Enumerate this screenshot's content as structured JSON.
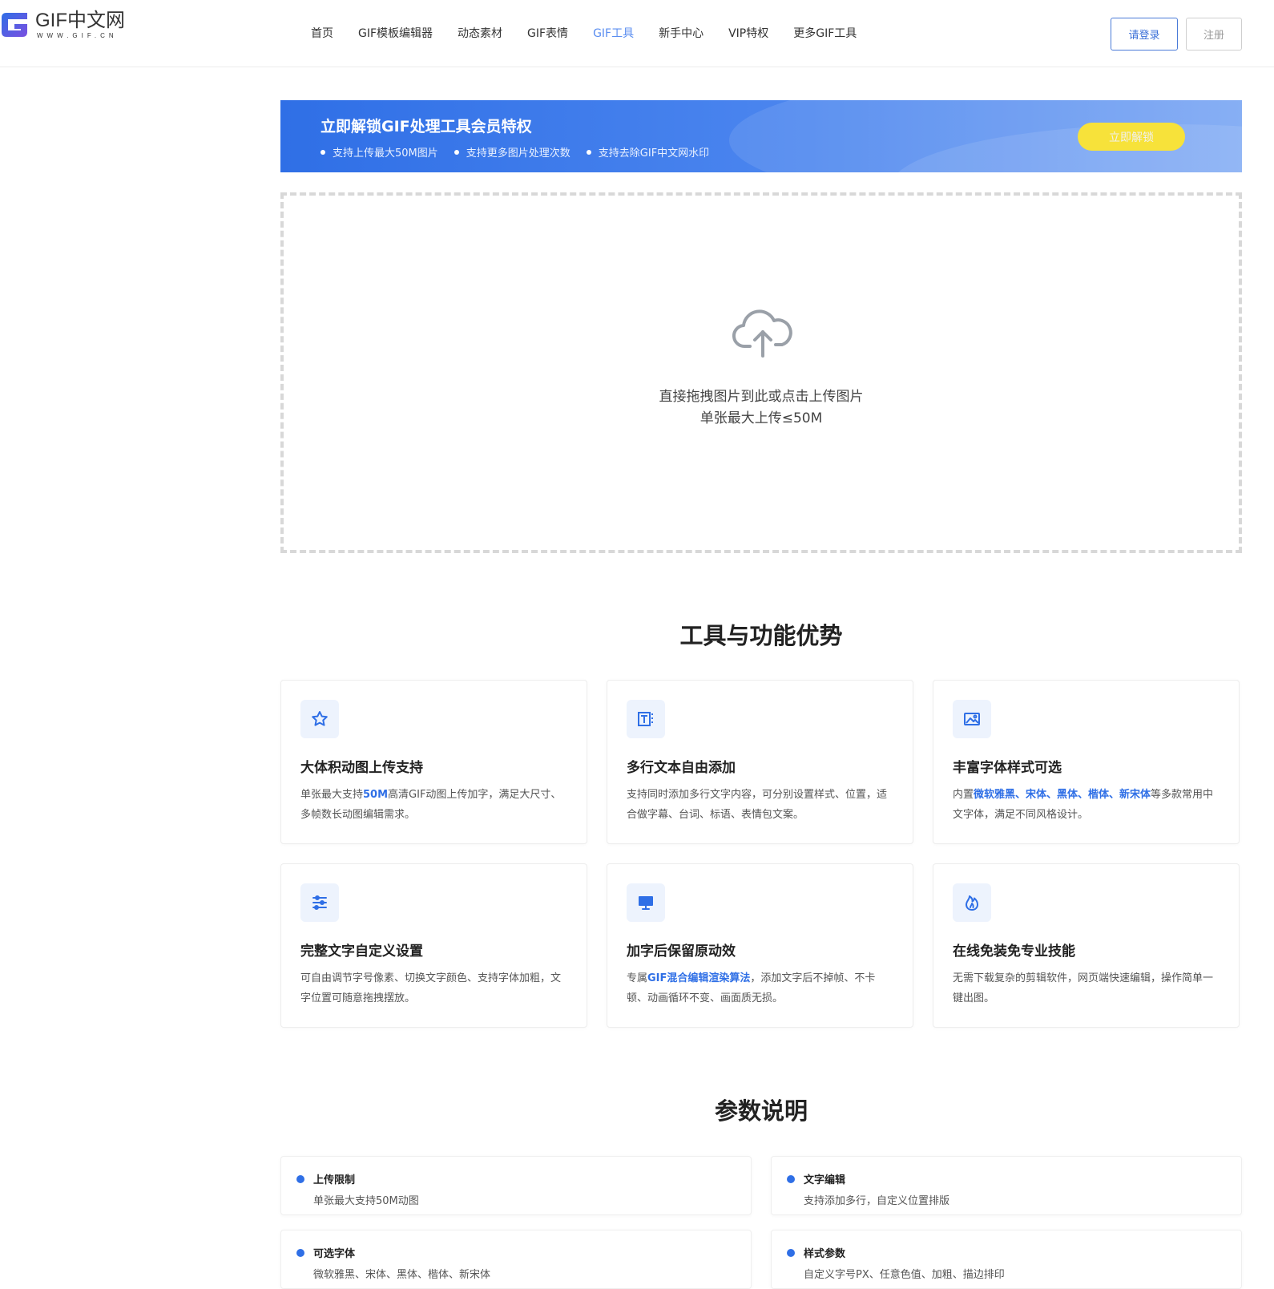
{
  "logo": {
    "text": "GIF中文网",
    "sub": "WWW.GIF.CN"
  },
  "nav": [
    {
      "label": "首页",
      "active": false
    },
    {
      "label": "GIF模板编辑器",
      "active": false
    },
    {
      "label": "动态素材",
      "active": false
    },
    {
      "label": "GIF表情",
      "active": false
    },
    {
      "label": "GIF工具",
      "active": true
    },
    {
      "label": "新手中心",
      "active": false
    },
    {
      "label": "VIP特权",
      "active": false
    },
    {
      "label": "更多GIF工具",
      "active": false
    }
  ],
  "auth": {
    "login": "请登录",
    "register": "注册"
  },
  "banner": {
    "title": "立即解锁GIF处理工具会员特权",
    "points": [
      "支持上传最大50M图片",
      "支持更多图片处理次数",
      "支持去除GIF中文网水印"
    ],
    "button": "立即解锁"
  },
  "upload": {
    "line1": "直接拖拽图片到此或点击上传图片",
    "line2": "单张最大上传≤50M"
  },
  "features": {
    "title": "工具与功能优势",
    "cards": [
      {
        "icon": "star-icon",
        "title": "大体积动图上传支持",
        "desc_parts": [
          {
            "text": "单张最大支持",
            "hl": false
          },
          {
            "text": "50M",
            "hl": true
          },
          {
            "text": "高清GIF动图上传加字，满足大尺寸、多帧数长动图编辑需求。",
            "hl": false
          }
        ]
      },
      {
        "icon": "text-layers-icon",
        "title": "多行文本自由添加",
        "desc_parts": [
          {
            "text": "支持同时添加多行文字内容，可分别设置样式、位置，适合做字幕、台词、标语、表情包文案。",
            "hl": false
          }
        ]
      },
      {
        "icon": "image-icon",
        "title": "丰富字体样式可选",
        "desc_parts": [
          {
            "text": "内置",
            "hl": false
          },
          {
            "text": "微软雅黑、宋体、黑体、楷体、新宋体",
            "hl": true
          },
          {
            "text": "等多款常用中文字体，满足不同风格设计。",
            "hl": false
          }
        ]
      },
      {
        "icon": "sliders-icon",
        "title": "完整文字自定义设置",
        "desc_parts": [
          {
            "text": "可自由调节字号像素、切换文字颜色、支持字体加粗，文字位置可随意拖拽摆放。",
            "hl": false
          }
        ]
      },
      {
        "icon": "screen-icon",
        "title": "加字后保留原动效",
        "desc_parts": [
          {
            "text": "专属",
            "hl": false
          },
          {
            "text": "GIF混合编辑渲染算法",
            "hl": true
          },
          {
            "text": "，添加文字后不掉帧、不卡顿、动画循环不变、画面质无损。",
            "hl": false
          }
        ]
      },
      {
        "icon": "flame-icon",
        "title": "在线免装免专业技能",
        "desc_parts": [
          {
            "text": "无需下载复杂的剪辑软件，网页端快速编辑，操作简单一键出图。",
            "hl": false
          }
        ]
      }
    ]
  },
  "params": {
    "title": "参数说明",
    "items": [
      {
        "label": "上传限制",
        "value": "单张最大支持50M动图"
      },
      {
        "label": "文字编辑",
        "value": "支持添加多行，自定义位置排版"
      },
      {
        "label": "可选字体",
        "value": "微软雅黑、宋体、黑体、楷体、新宋体"
      },
      {
        "label": "样式参数",
        "value": "自定义字号PX、任意色值、加粗、描边排印"
      }
    ]
  },
  "colors": {
    "accent": "#2f6fe6",
    "nav_active": "#5b8ef0",
    "banner_button": "#f7e23a"
  }
}
